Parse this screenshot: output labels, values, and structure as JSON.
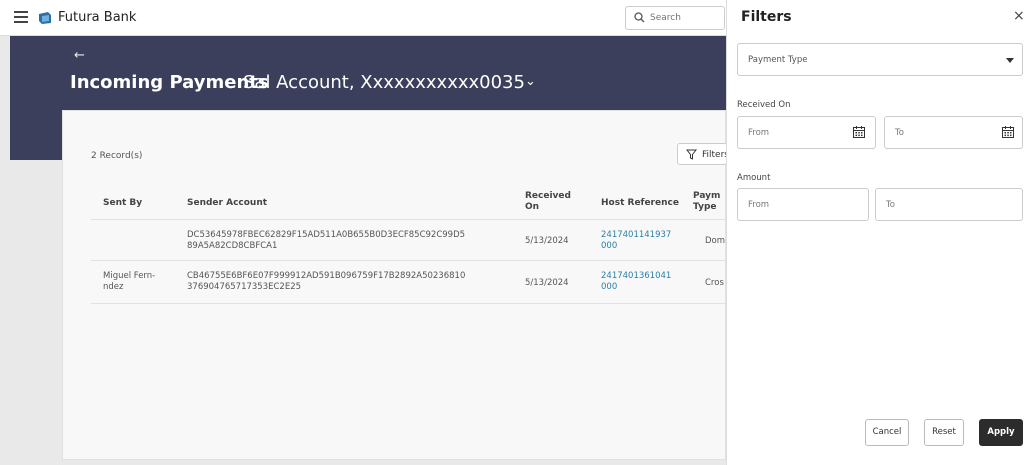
{
  "brand": "Futura Bank",
  "search": {
    "placeholder": "Search"
  },
  "header": {
    "back_arrow": "←",
    "title_bold": "Incoming Payments",
    "title_account": "Sal Account, Xxxxxxxxxxx0035",
    "chevron": "⌄"
  },
  "card": {
    "records": "2 Record(s)",
    "filters_label": "Filters",
    "columns": [
      "Sent By",
      "Sender Account",
      "Received On",
      "Host Reference",
      "Payment Type"
    ],
    "column_display": {
      "received_line1": "Received",
      "received_line2": "On",
      "payment_line1": "Paym",
      "payment_line2": "Type"
    },
    "rows": [
      {
        "sent_by_1": "",
        "sent_by_2": "",
        "account_1": "DC53645978FBEC62829F15AD511A0B655B0D3ECF85C92C99D5",
        "account_2": "89A5A82CD8CBFCA1",
        "received": "5/13/2024",
        "ref_1": "2417401141937",
        "ref_2": "000",
        "type": "Dom"
      },
      {
        "sent_by_1": "Miguel Fern-",
        "sent_by_2": "ndez",
        "account_1": "CB46755E6BF6E07F999912AD591B096759F17B2892A50236810",
        "account_2": "376904765717353EC2E25",
        "received": "5/13/2024",
        "ref_1": "2417401361041",
        "ref_2": "000",
        "type": "Cros"
      }
    ]
  },
  "panel": {
    "title": "Filters",
    "close": "×",
    "payment_type_placeholder": "Payment Type",
    "received_on_label": "Received On",
    "from_placeholder": "From",
    "to_placeholder": "To",
    "amount_label": "Amount",
    "amount_from_placeholder": "From",
    "amount_to_placeholder": "To",
    "cancel": "Cancel",
    "reset": "Reset",
    "apply": "Apply"
  },
  "colors": {
    "hero": "#3b3f5c",
    "link": "#2a7fa8",
    "apply": "#2c2c2c"
  },
  "icons": [
    "menu-icon",
    "logo-icon",
    "search-icon",
    "back-arrow-icon",
    "chevron-down-icon",
    "filter-icon",
    "calendar-icon",
    "close-icon"
  ]
}
